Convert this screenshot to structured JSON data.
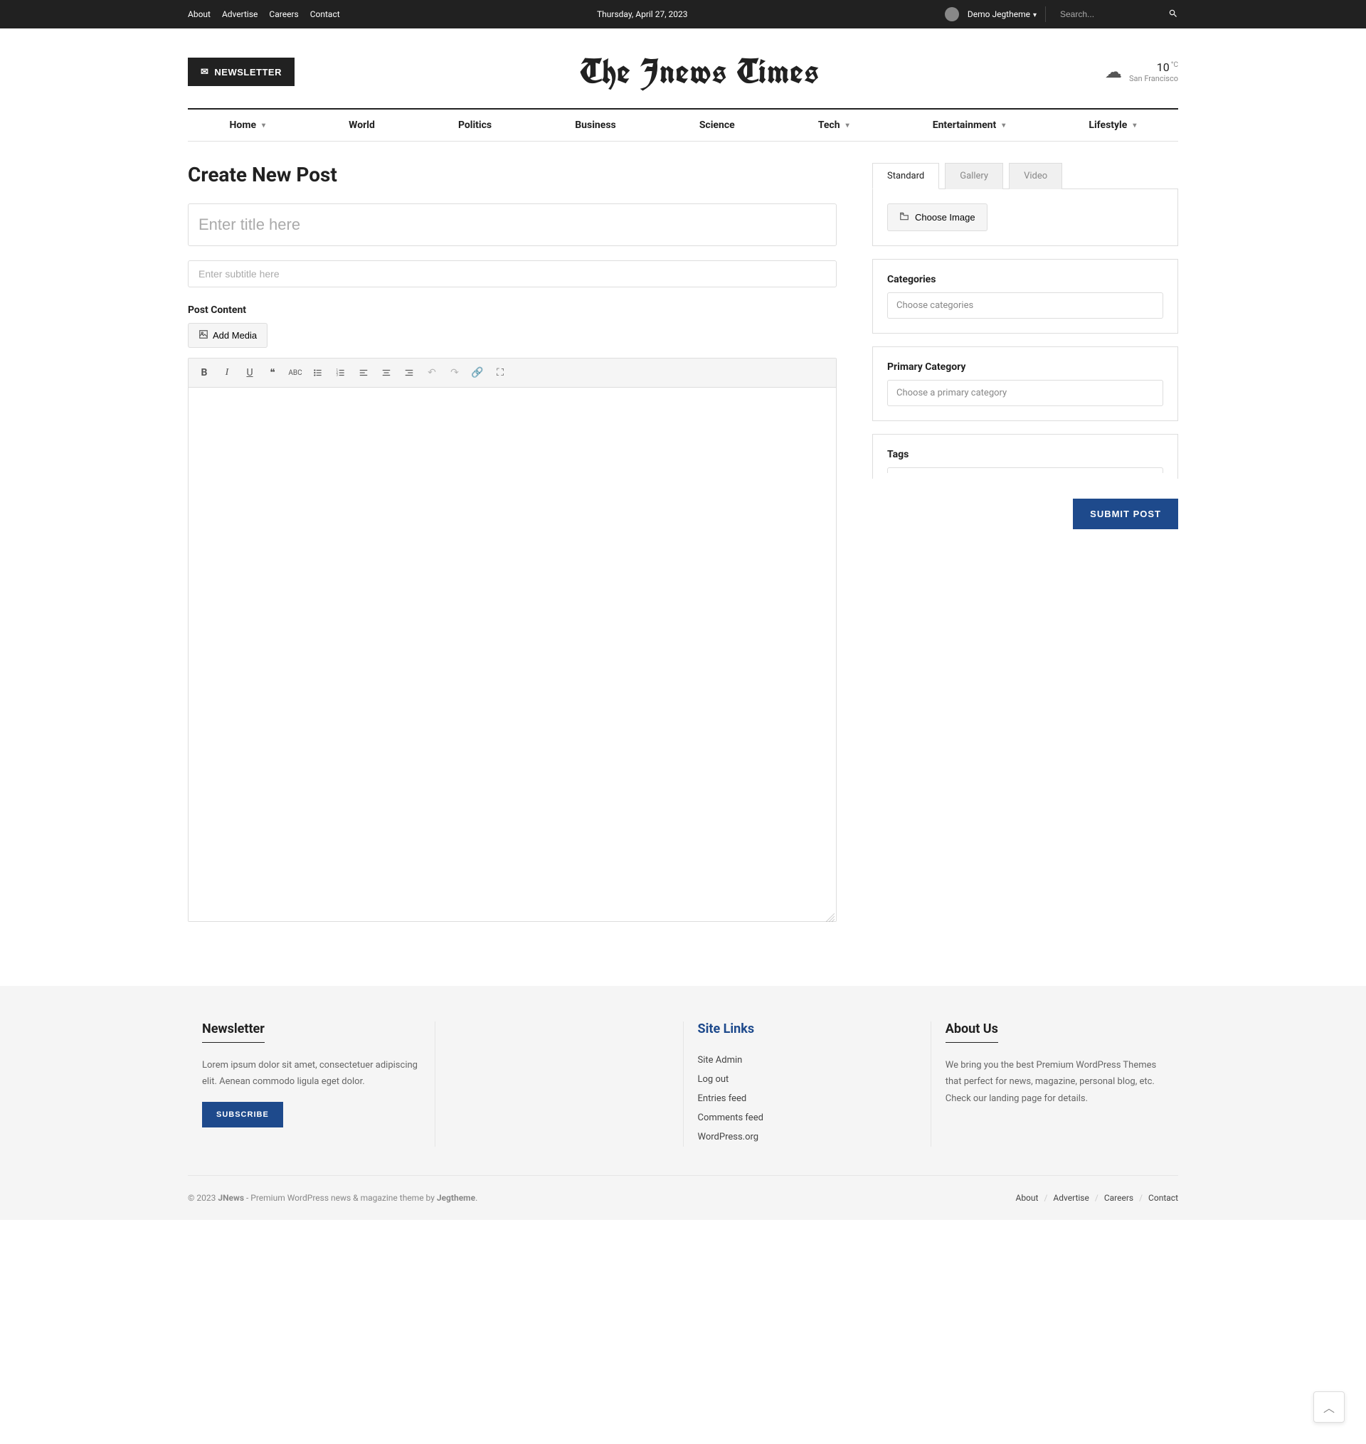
{
  "topbar": {
    "links": [
      "About",
      "Advertise",
      "Careers",
      "Contact"
    ],
    "date": "Thursday, April 27, 2023",
    "user": "Demo Jegtheme",
    "search_placeholder": "Search..."
  },
  "header": {
    "newsletter_label": "NEWSLETTER",
    "logo": "The Jnews Times",
    "weather": {
      "temp": "10",
      "unit": "°C",
      "location": "San Francisco"
    }
  },
  "nav": {
    "items": [
      {
        "label": "Home",
        "dropdown": true
      },
      {
        "label": "World",
        "dropdown": false
      },
      {
        "label": "Politics",
        "dropdown": false
      },
      {
        "label": "Business",
        "dropdown": false
      },
      {
        "label": "Science",
        "dropdown": false
      },
      {
        "label": "Tech",
        "dropdown": true
      },
      {
        "label": "Entertainment",
        "dropdown": true
      },
      {
        "label": "Lifestyle",
        "dropdown": true
      }
    ]
  },
  "editor": {
    "page_title": "Create New Post",
    "title_placeholder": "Enter title here",
    "subtitle_placeholder": "Enter subtitle here",
    "content_label": "Post Content",
    "add_media": "Add Media",
    "submit": "SUBMIT POST"
  },
  "sidebar": {
    "tabs": [
      "Standard",
      "Gallery",
      "Video"
    ],
    "choose_image": "Choose Image",
    "categories": {
      "label": "Categories",
      "placeholder": "Choose categories"
    },
    "primary": {
      "label": "Primary Category",
      "placeholder": "Choose a primary category"
    },
    "tags": {
      "label": "Tags"
    }
  },
  "footer": {
    "newsletter": {
      "title": "Newsletter",
      "text": "Lorem ipsum dolor sit amet, consectetuer adipiscing elit. Aenean commodo ligula eget dolor.",
      "button": "SUBSCRIBE"
    },
    "sitelinks": {
      "title": "Site Links",
      "items": [
        "Site Admin",
        "Log out",
        "Entries feed",
        "Comments feed",
        "WordPress.org"
      ]
    },
    "about": {
      "title": "About Us",
      "text": "We bring you the best Premium WordPress Themes that perfect for news, magazine, personal blog, etc. Check our landing page for details."
    },
    "copyright": {
      "prefix": "© 2023 ",
      "brand": "JNews",
      "mid": " - Premium WordPress news & magazine theme by ",
      "link": "Jegtheme"
    },
    "bottom_links": [
      "About",
      "Advertise",
      "Careers",
      "Contact"
    ]
  }
}
